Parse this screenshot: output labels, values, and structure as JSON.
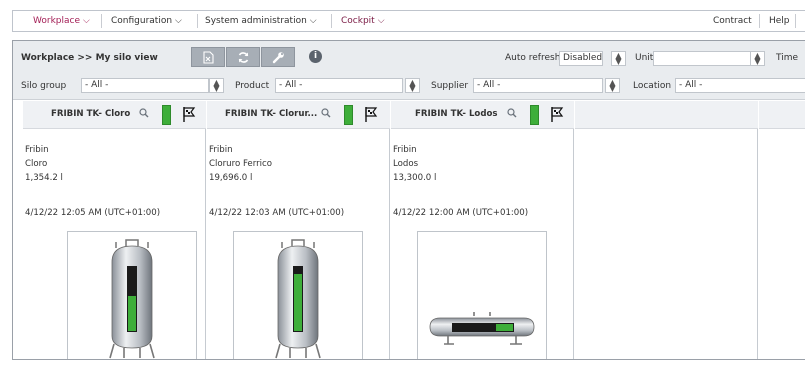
{
  "nav": {
    "items": [
      {
        "label": "Workplace",
        "active": true
      },
      {
        "label": "Configuration"
      },
      {
        "label": "System administration"
      },
      {
        "label": "Cockpit"
      }
    ],
    "contract": "Contract",
    "help": "Help"
  },
  "toolbar": {
    "breadcrumb": "Workplace >> My silo view",
    "buttons": [
      "export-excel-icon",
      "refresh-icon",
      "wrench-icon"
    ],
    "info": "i",
    "auto_refresh_label": "Auto refresh",
    "auto_refresh_value": "Disabled",
    "unit_label": "Unit",
    "unit_value": "",
    "time_label": "Time"
  },
  "filters": {
    "silo_group_label": "Silo group",
    "silo_group_value": "- All -",
    "product_label": "Product",
    "product_value": "- All -",
    "supplier_label": "Supplier",
    "supplier_value": "- All -",
    "location_label": "Location",
    "location_value": "- All -"
  },
  "silos": [
    {
      "title": "FRIBIN TK- Cloro",
      "supplier": "Fribin",
      "product": "Cloro",
      "quantity": "1,354.2 l",
      "timestamp": "4/12/22 12:05 AM (UTC+01:00)",
      "tank_type": "vertical",
      "fill_level": 0.55
    },
    {
      "title": "FRIBIN TK- Clorur...",
      "supplier": "Fribin",
      "product": "Cloruro Ferrico",
      "quantity": "19,696.0 l",
      "timestamp": "4/12/22 12:03 AM (UTC+01:00)",
      "tank_type": "vertical",
      "fill_level": 0.85
    },
    {
      "title": "FRIBIN TK- Lodos",
      "supplier": "Fribin",
      "product": "Lodos",
      "quantity": "13,300.0 l",
      "timestamp": "4/12/22 12:00 AM (UTC+01:00)",
      "tank_type": "horizontal",
      "fill_level": 0.3
    }
  ],
  "colors": {
    "accent": "#a42057",
    "fill": "#3eae3a",
    "empty": "#1a1a1a"
  }
}
